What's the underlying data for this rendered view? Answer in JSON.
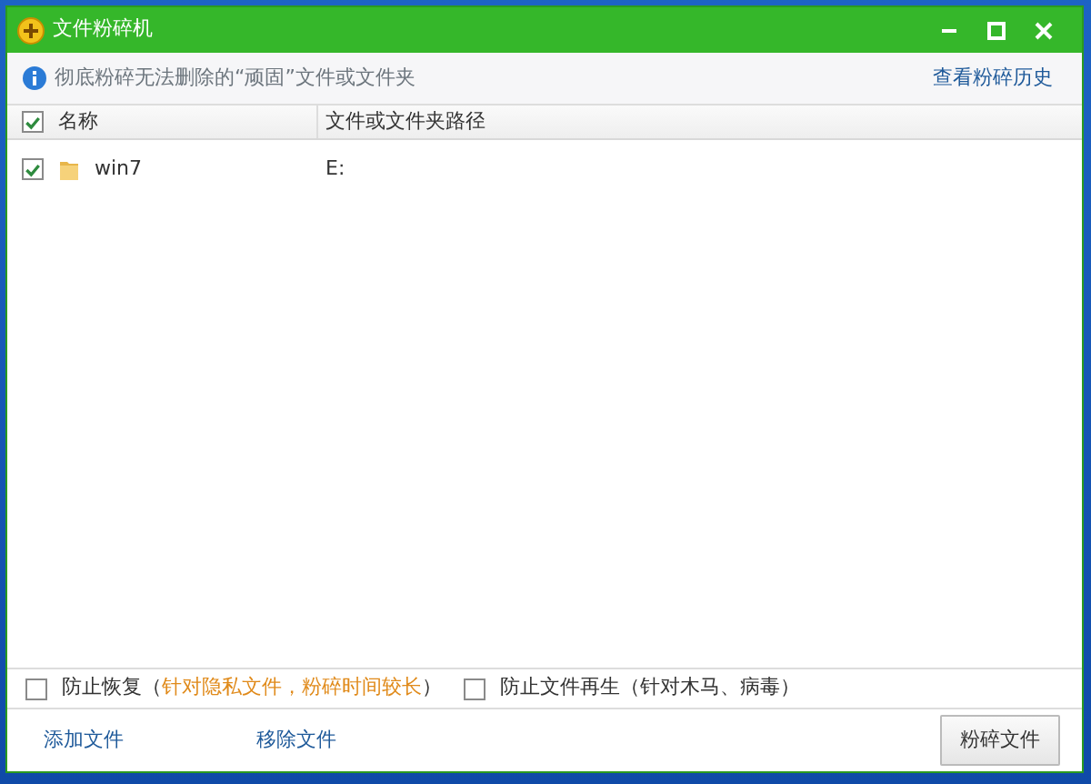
{
  "window": {
    "title": "文件粉碎机",
    "controls": [
      {
        "kind": "minimize"
      },
      {
        "kind": "maximize"
      },
      {
        "kind": "close"
      }
    ]
  },
  "info_bar": {
    "message": "彻底粉碎无法删除的“顽固”文件或文件夹",
    "history_link": "查看粉碎历史"
  },
  "table": {
    "select_all": {
      "checked": true
    },
    "columns": [
      "名称",
      "文件或文件夹路径"
    ],
    "rows": [
      {
        "name": "win7",
        "path": "E:",
        "checked": true
      }
    ]
  },
  "options": [
    {
      "checked": false,
      "segments": [
        {
          "text": "防止恢复（",
          "highlight": false
        },
        {
          "text": "针对隐私文件，粉碎时间较长",
          "highlight": true
        },
        {
          "text": "）",
          "highlight": false
        }
      ]
    },
    {
      "checked": false,
      "segments": [
        {
          "text": "防止文件再生（针对木马、病毒）",
          "highlight": false
        }
      ]
    }
  ],
  "footer": {
    "links": [
      "添加文件",
      "移除文件"
    ],
    "button": "粉碎文件"
  }
}
